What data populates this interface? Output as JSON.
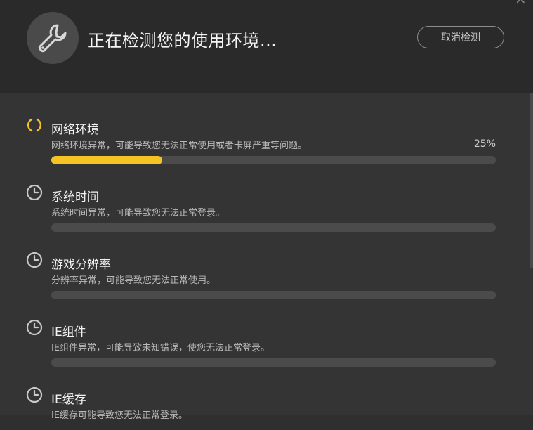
{
  "header": {
    "title": "正在检测您的使用环境...",
    "cancel_label": "取消检测",
    "close_glyph": "×"
  },
  "items": [
    {
      "name": "网络环境",
      "desc": "网络环境异常，可能导致您无法正常使用或者卡屏严重等问题。",
      "status": "checking",
      "progress_label": "25%",
      "progress": 0.25
    },
    {
      "name": "系统时间",
      "desc": "系统时间异常，可能导致您无法正常登录。",
      "status": "pending",
      "progress": 0
    },
    {
      "name": "游戏分辨率",
      "desc": "分辨率异常，可能导致您无法正常使用。",
      "status": "pending",
      "progress": 0
    },
    {
      "name": "IE组件",
      "desc": "IE组件异常，可能导致未知错误，使您无法正常登录。",
      "status": "pending",
      "progress": 0
    },
    {
      "name": "IE缓存",
      "desc": "IE缓存可能导致您无法正常登录。",
      "status": "pending",
      "progress": 0
    }
  ],
  "colors": {
    "accent": "#f6c324",
    "track": "#4b4b4b",
    "header_bg": "#2a2a2a",
    "list_bg": "#343434"
  }
}
